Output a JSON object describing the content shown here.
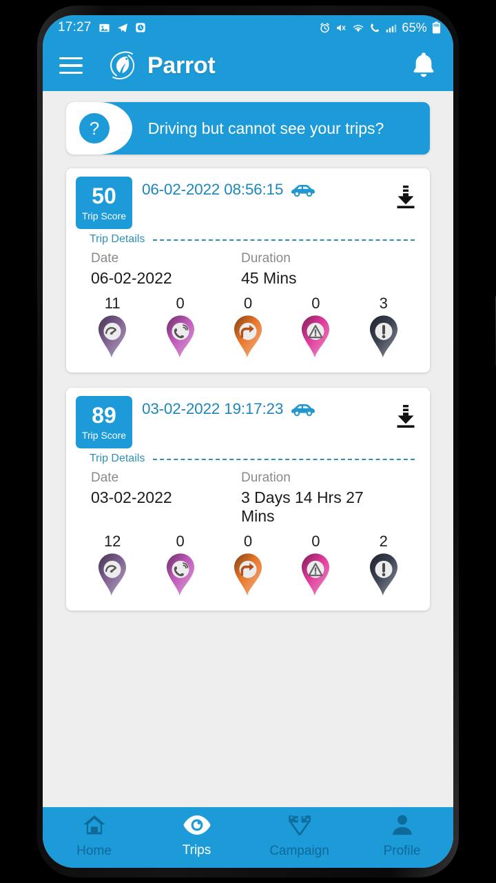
{
  "status_bar": {
    "time": "17:27",
    "left_icons": [
      "image-icon",
      "telegram-icon",
      "clock-icon"
    ],
    "right_icons": [
      "alarm-icon",
      "mute-vibrate-icon",
      "wifi-icon",
      "call-signal-icon",
      "signal-bars-icon"
    ],
    "battery_percent": "65%",
    "background_color": "#1C9BD8"
  },
  "app_bar": {
    "menu_icon": "hamburger-icon",
    "brand_name": "Parrot",
    "logo_icon": "parrot-bird-logo",
    "notification_icon": "bell-icon",
    "background_color": "#1C9BD8"
  },
  "banner": {
    "question_mark": "?",
    "text": "Driving but cannot see your trips?",
    "background_color": "#1C9BD8"
  },
  "trips": [
    {
      "score": "50",
      "score_label": "Trip Score",
      "datetime": "06-02-2022 08:56:15",
      "vehicle_icon": "car-icon",
      "download_icon": "download-icon",
      "details_label": "Trip Details",
      "date_label": "Date",
      "date_value": "06-02-2022",
      "duration_label": "Duration",
      "duration_value": "45 Mins",
      "metrics": [
        {
          "name": "overspeeding",
          "icon": "speedometer-pin-icon",
          "count": "11",
          "color": "#7C5E8E"
        },
        {
          "name": "phone-usage",
          "icon": "phone-call-pin-icon",
          "count": "0",
          "color": "#BF58B8"
        },
        {
          "name": "sharp-turn",
          "icon": "sharp-turn-pin-icon",
          "count": "0",
          "color": "#E8762A"
        },
        {
          "name": "harsh-warning",
          "icon": "warning-pin-icon",
          "count": "0",
          "color": "#E0399B"
        },
        {
          "name": "alerts",
          "icon": "exclamation-pin-icon",
          "count": "3",
          "color": "#39404F"
        }
      ]
    },
    {
      "score": "89",
      "score_label": "Trip Score",
      "datetime": "03-02-2022 19:17:23",
      "vehicle_icon": "car-icon",
      "download_icon": "download-icon",
      "details_label": "Trip Details",
      "date_label": "Date",
      "date_value": "03-02-2022",
      "duration_label": "Duration",
      "duration_value": "3 Days 14 Hrs 27 Mins",
      "metrics": [
        {
          "name": "overspeeding",
          "icon": "speedometer-pin-icon",
          "count": "12",
          "color": "#7C5E8E"
        },
        {
          "name": "phone-usage",
          "icon": "phone-call-pin-icon",
          "count": "0",
          "color": "#BF58B8"
        },
        {
          "name": "sharp-turn",
          "icon": "sharp-turn-pin-icon",
          "count": "0",
          "color": "#E8762A"
        },
        {
          "name": "harsh-warning",
          "icon": "warning-pin-icon",
          "count": "0",
          "color": "#E0399B"
        },
        {
          "name": "alerts",
          "icon": "exclamation-pin-icon",
          "count": "2",
          "color": "#39404F"
        }
      ]
    }
  ],
  "bottom_nav": {
    "items": [
      {
        "label": "Home",
        "icon": "home-icon",
        "active": false
      },
      {
        "label": "Trips",
        "icon": "eye-icon",
        "active": true
      },
      {
        "label": "Campaign",
        "icon": "checkered-flags-icon",
        "active": false
      },
      {
        "label": "Profile",
        "icon": "person-icon",
        "active": false
      }
    ],
    "background_color": "#1C9BD8",
    "active_color": "#FFFFFF",
    "inactive_color": "#0E6A99"
  }
}
